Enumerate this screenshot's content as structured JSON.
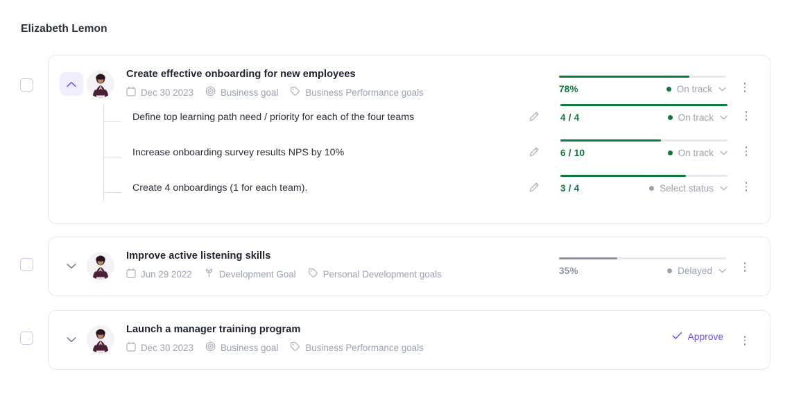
{
  "header": {
    "owner_name": "Elizabeth Lemon"
  },
  "icons": {
    "calendar": "calendar-icon",
    "target": "target-icon",
    "tag": "tag-icon",
    "sprout": "sprout-icon",
    "pencil": "pencil-icon",
    "check": "check-icon",
    "chevron_up": "chevron-up-icon",
    "chevron_down": "chevron-down-icon",
    "kebab": "more-options-icon"
  },
  "colors": {
    "green": "#0b7a3b",
    "grey": "#8b93a3",
    "purple": "#6d4df6",
    "track": "#e7e9ee",
    "card_border": "#e8e7ef"
  },
  "goals": [
    {
      "title": "Create effective onboarding for new employees",
      "date": "Dec 30 2023",
      "type": "Business goal",
      "type_icon": "target-icon",
      "category": "Business Performance goals",
      "expanded": true,
      "progress_label": "78%",
      "progress_percent": 78,
      "progress_color": "green",
      "status": "On track",
      "status_color": "green",
      "subgoals": [
        {
          "title": "Define top learning path need / priority for each of the four teams",
          "progress_label": "4 / 4",
          "progress_percent": 100,
          "progress_color": "green",
          "status": "On track",
          "status_color": "green"
        },
        {
          "title": "Increase onboarding survey results NPS by 10%",
          "progress_label": "6 / 10",
          "progress_percent": 60,
          "progress_color": "green",
          "status": "On track",
          "status_color": "green"
        },
        {
          "title": "Create 4 onboardings (1 for each team).",
          "progress_label": "3 / 4",
          "progress_percent": 75,
          "progress_color": "green",
          "status": "Select status",
          "status_color": "grey"
        }
      ]
    },
    {
      "title": "Improve active listening skills",
      "date": "Jun 29 2022",
      "type": "Development Goal",
      "type_icon": "sprout-icon",
      "category": "Personal Development goals",
      "expanded": false,
      "progress_label": "35%",
      "progress_percent": 35,
      "progress_color": "grey",
      "status": "Delayed",
      "status_color": "grey",
      "subgoals": []
    },
    {
      "title": "Launch a manager training program",
      "date": "Dec 30 2023",
      "type": "Business goal",
      "type_icon": "target-icon",
      "category": "Business Performance goals",
      "expanded": false,
      "action_label": "Approve",
      "subgoals": []
    }
  ]
}
